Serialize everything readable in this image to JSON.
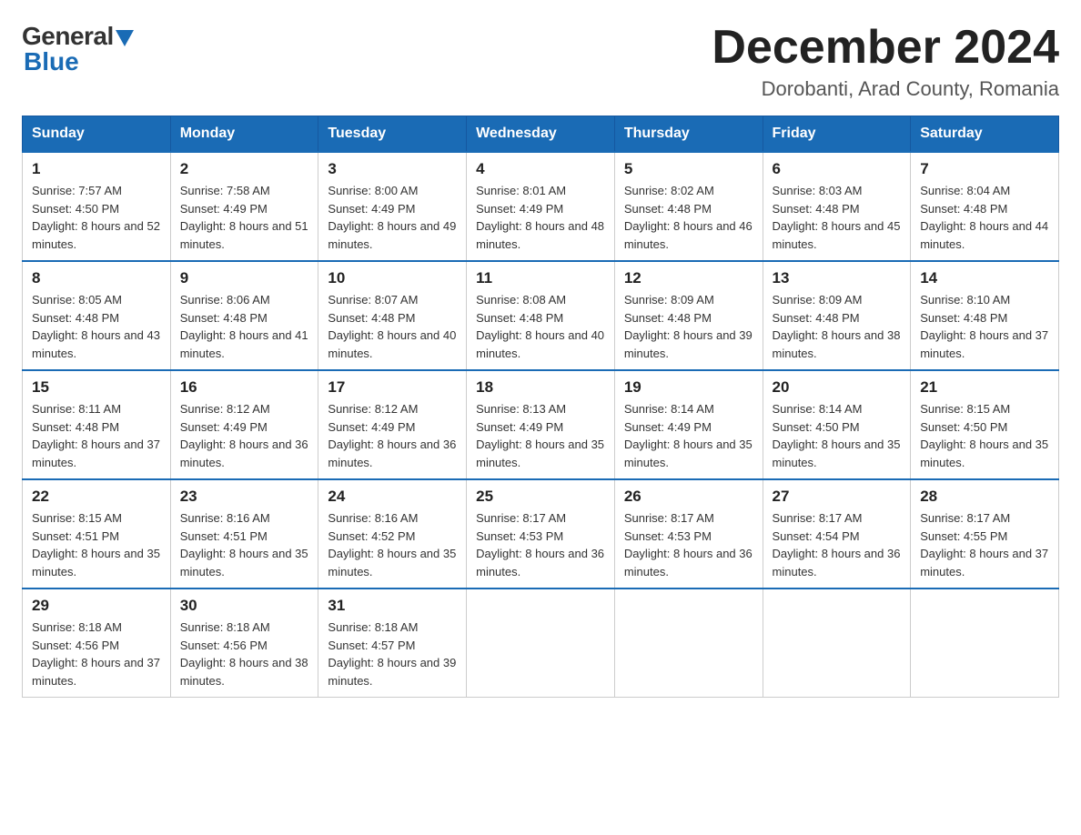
{
  "header": {
    "logo_general": "General",
    "logo_blue": "Blue",
    "month_title": "December 2024",
    "location": "Dorobanti, Arad County, Romania"
  },
  "days_of_week": [
    "Sunday",
    "Monday",
    "Tuesday",
    "Wednesday",
    "Thursday",
    "Friday",
    "Saturday"
  ],
  "weeks": [
    [
      {
        "day": "1",
        "sunrise": "7:57 AM",
        "sunset": "4:50 PM",
        "daylight": "8 hours and 52 minutes."
      },
      {
        "day": "2",
        "sunrise": "7:58 AM",
        "sunset": "4:49 PM",
        "daylight": "8 hours and 51 minutes."
      },
      {
        "day": "3",
        "sunrise": "8:00 AM",
        "sunset": "4:49 PM",
        "daylight": "8 hours and 49 minutes."
      },
      {
        "day": "4",
        "sunrise": "8:01 AM",
        "sunset": "4:49 PM",
        "daylight": "8 hours and 48 minutes."
      },
      {
        "day": "5",
        "sunrise": "8:02 AM",
        "sunset": "4:48 PM",
        "daylight": "8 hours and 46 minutes."
      },
      {
        "day": "6",
        "sunrise": "8:03 AM",
        "sunset": "4:48 PM",
        "daylight": "8 hours and 45 minutes."
      },
      {
        "day": "7",
        "sunrise": "8:04 AM",
        "sunset": "4:48 PM",
        "daylight": "8 hours and 44 minutes."
      }
    ],
    [
      {
        "day": "8",
        "sunrise": "8:05 AM",
        "sunset": "4:48 PM",
        "daylight": "8 hours and 43 minutes."
      },
      {
        "day": "9",
        "sunrise": "8:06 AM",
        "sunset": "4:48 PM",
        "daylight": "8 hours and 41 minutes."
      },
      {
        "day": "10",
        "sunrise": "8:07 AM",
        "sunset": "4:48 PM",
        "daylight": "8 hours and 40 minutes."
      },
      {
        "day": "11",
        "sunrise": "8:08 AM",
        "sunset": "4:48 PM",
        "daylight": "8 hours and 40 minutes."
      },
      {
        "day": "12",
        "sunrise": "8:09 AM",
        "sunset": "4:48 PM",
        "daylight": "8 hours and 39 minutes."
      },
      {
        "day": "13",
        "sunrise": "8:09 AM",
        "sunset": "4:48 PM",
        "daylight": "8 hours and 38 minutes."
      },
      {
        "day": "14",
        "sunrise": "8:10 AM",
        "sunset": "4:48 PM",
        "daylight": "8 hours and 37 minutes."
      }
    ],
    [
      {
        "day": "15",
        "sunrise": "8:11 AM",
        "sunset": "4:48 PM",
        "daylight": "8 hours and 37 minutes."
      },
      {
        "day": "16",
        "sunrise": "8:12 AM",
        "sunset": "4:49 PM",
        "daylight": "8 hours and 36 minutes."
      },
      {
        "day": "17",
        "sunrise": "8:12 AM",
        "sunset": "4:49 PM",
        "daylight": "8 hours and 36 minutes."
      },
      {
        "day": "18",
        "sunrise": "8:13 AM",
        "sunset": "4:49 PM",
        "daylight": "8 hours and 35 minutes."
      },
      {
        "day": "19",
        "sunrise": "8:14 AM",
        "sunset": "4:49 PM",
        "daylight": "8 hours and 35 minutes."
      },
      {
        "day": "20",
        "sunrise": "8:14 AM",
        "sunset": "4:50 PM",
        "daylight": "8 hours and 35 minutes."
      },
      {
        "day": "21",
        "sunrise": "8:15 AM",
        "sunset": "4:50 PM",
        "daylight": "8 hours and 35 minutes."
      }
    ],
    [
      {
        "day": "22",
        "sunrise": "8:15 AM",
        "sunset": "4:51 PM",
        "daylight": "8 hours and 35 minutes."
      },
      {
        "day": "23",
        "sunrise": "8:16 AM",
        "sunset": "4:51 PM",
        "daylight": "8 hours and 35 minutes."
      },
      {
        "day": "24",
        "sunrise": "8:16 AM",
        "sunset": "4:52 PM",
        "daylight": "8 hours and 35 minutes."
      },
      {
        "day": "25",
        "sunrise": "8:17 AM",
        "sunset": "4:53 PM",
        "daylight": "8 hours and 36 minutes."
      },
      {
        "day": "26",
        "sunrise": "8:17 AM",
        "sunset": "4:53 PM",
        "daylight": "8 hours and 36 minutes."
      },
      {
        "day": "27",
        "sunrise": "8:17 AM",
        "sunset": "4:54 PM",
        "daylight": "8 hours and 36 minutes."
      },
      {
        "day": "28",
        "sunrise": "8:17 AM",
        "sunset": "4:55 PM",
        "daylight": "8 hours and 37 minutes."
      }
    ],
    [
      {
        "day": "29",
        "sunrise": "8:18 AM",
        "sunset": "4:56 PM",
        "daylight": "8 hours and 37 minutes."
      },
      {
        "day": "30",
        "sunrise": "8:18 AM",
        "sunset": "4:56 PM",
        "daylight": "8 hours and 38 minutes."
      },
      {
        "day": "31",
        "sunrise": "8:18 AM",
        "sunset": "4:57 PM",
        "daylight": "8 hours and 39 minutes."
      },
      null,
      null,
      null,
      null
    ]
  ]
}
